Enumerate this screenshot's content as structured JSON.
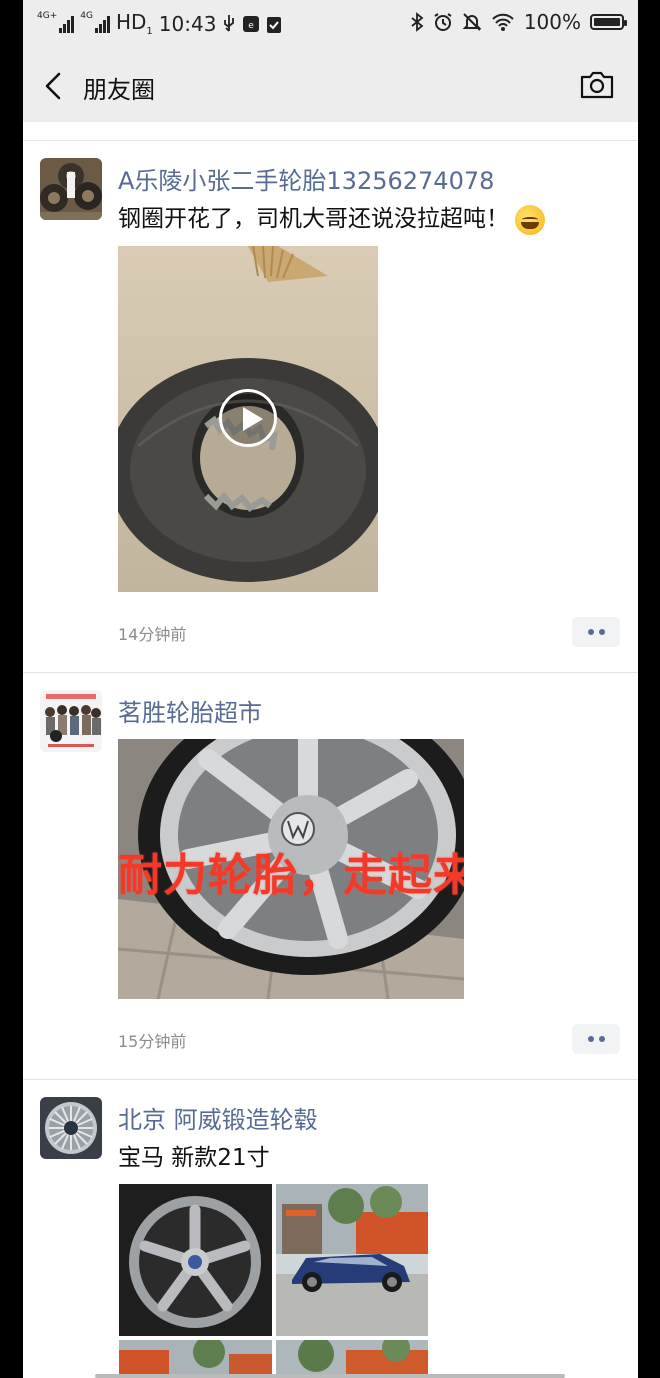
{
  "status_bar": {
    "network_1": "4G+",
    "network_2": "4G",
    "hd": "HD",
    "hd_sub": "1",
    "time": "10:43",
    "battery": "100%"
  },
  "nav": {
    "title": "朋友圈",
    "back_icon": "chevron-left-icon",
    "camera_icon": "camera-icon"
  },
  "posts": [
    {
      "author": "A乐陵小张二手轮胎13256274078",
      "text": "钢圈开花了，司机大哥还说没拉超吨！",
      "emoji": "laughing-tears-emoji",
      "media_type": "video",
      "time": "14分钟前"
    },
    {
      "author": "茗胜轮胎超市",
      "media_type": "image",
      "overlay_text": "耐力轮胎，走起来",
      "time": "15分钟前"
    },
    {
      "author": "北京 阿威锻造轮毂",
      "text": "宝马 新款21寸",
      "media_type": "image-grid"
    }
  ],
  "colors": {
    "author_link": "#576b95",
    "nav_background": "#ededed",
    "overlay_text": "#f23a2a"
  }
}
